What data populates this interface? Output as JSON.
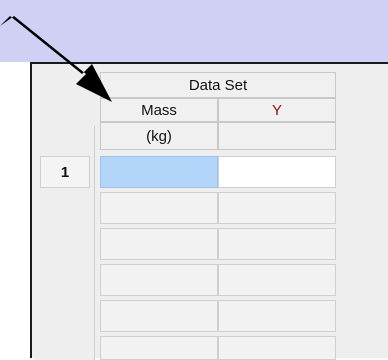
{
  "table": {
    "group_header": "Data Set",
    "columns": [
      {
        "name": "Mass",
        "unit": "(kg)"
      },
      {
        "name": "Y",
        "unit": ""
      }
    ],
    "row_numbers": [
      "1"
    ]
  },
  "colors": {
    "window_background": "#d0d0f4",
    "selected_cell": "#b3d5fa",
    "y_column_label": "#8b1010"
  },
  "annotation": {
    "icon": "arrow-icon"
  }
}
